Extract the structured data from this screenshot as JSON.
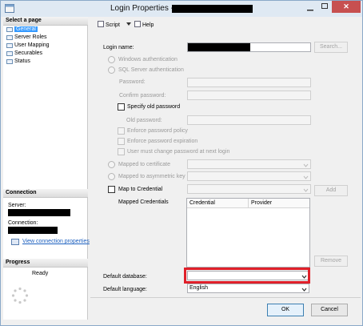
{
  "window": {
    "title": "Login Properties -",
    "close_glyph": "✕"
  },
  "left_panel": {
    "select_page_header": "Select a page",
    "pages": [
      {
        "label": "General",
        "selected": true
      },
      {
        "label": "Server Roles",
        "selected": false
      },
      {
        "label": "User Mapping",
        "selected": false
      },
      {
        "label": "Securables",
        "selected": false
      },
      {
        "label": "Status",
        "selected": false
      }
    ],
    "connection_header": "Connection",
    "server_label": "Server:",
    "connection_label": "Connection:",
    "view_connection_link": "View connection properties",
    "progress_header": "Progress",
    "progress_status": "Ready"
  },
  "toolbar": {
    "script_label": "Script",
    "help_label": "Help"
  },
  "form": {
    "login_name_label": "Login name:",
    "search_button": "Search...",
    "windows_auth": "Windows authentication",
    "sql_auth": "SQL Server authentication",
    "password_label": "Password:",
    "confirm_password_label": "Confirm password:",
    "specify_old_password": "Specify old password",
    "old_password_label": "Old password:",
    "enforce_policy": "Enforce password policy",
    "enforce_expiration": "Enforce password expiration",
    "must_change": "User must change password at next login",
    "mapped_cert": "Mapped to certificate",
    "mapped_asym_key": "Mapped to asymmetric key",
    "map_to_credential": "Map to Credential",
    "add_button": "Add",
    "mapped_credentials_label": "Mapped Credentials",
    "credentials_columns": [
      "Credential",
      "Provider"
    ],
    "remove_button": "Remove",
    "default_database_label": "Default database:",
    "default_database_value": "",
    "default_language_label": "Default language:",
    "default_language_value": "English"
  },
  "footer": {
    "ok_button": "OK",
    "cancel_button": "Cancel"
  },
  "colors": {
    "highlight": "#e0202a",
    "selection": "#3399ff",
    "link": "#1b5fbf"
  }
}
